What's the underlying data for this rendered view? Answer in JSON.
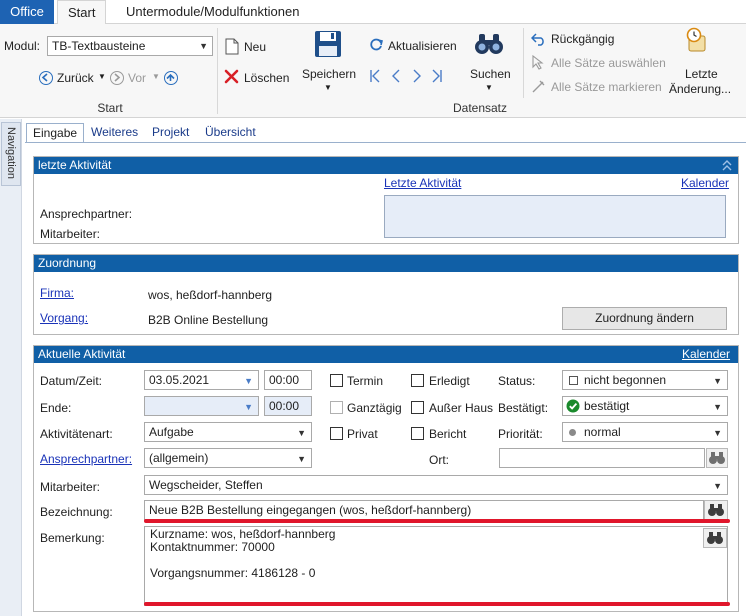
{
  "ribbon_tabs": [
    "Office",
    "Start",
    "Untermodule/Modulfunktionen"
  ],
  "modul": {
    "label": "Modul:",
    "value": "TB-Textbausteine"
  },
  "nav": {
    "back": "Zurück",
    "forward": "Vor",
    "group_label": "Start"
  },
  "actions": {
    "neu": "Neu",
    "loeschen": "Löschen",
    "speichern": "Speichern",
    "aktualisieren": "Aktualisieren",
    "suchen": "Suchen",
    "datensatz_label": "Datensatz",
    "rueckgaengig": "Rückgängig",
    "alle_auswaehlen": "Alle Sätze auswählen",
    "alle_markieren": "Alle Sätze markieren",
    "letzte_line1": "Letzte",
    "letzte_line2": "Änderung..."
  },
  "navigation_panel": "Navigation",
  "content_tabs": [
    "Eingabe",
    "Weiteres",
    "Projekt",
    "Übersicht"
  ],
  "letzte_aktivitaet": {
    "title": "letzte Aktivität",
    "link_letzte": "Letzte Aktivität",
    "link_kalender": "Kalender",
    "ansprechpartner_label": "Ansprechpartner:",
    "mitarbeiter_label": "Mitarbeiter:"
  },
  "zuordnung": {
    "title": "Zuordnung",
    "firma_label": "Firma:",
    "firma_value": "wos, heßdorf-hannberg",
    "vorgang_label": "Vorgang:",
    "vorgang_value": "B2B Online Bestellung",
    "button": "Zuordnung ändern"
  },
  "aktivitaet": {
    "title": "Aktuelle Aktivität",
    "kalender": "Kalender",
    "datum_label": "Datum/Zeit:",
    "datum_value": "03.05.2021",
    "zeit_value": "00:00",
    "ende_label": "Ende:",
    "ende_zeit": "00:00",
    "termin": "Termin",
    "erledigt": "Erledigt",
    "ganztaegig": "Ganztägig",
    "ausser_haus": "Außer Haus",
    "privat": "Privat",
    "bericht": "Bericht",
    "status_label": "Status:",
    "status_value": "nicht begonnen",
    "bestaetigt_label": "Bestätigt:",
    "bestaetigt_value": "bestätigt",
    "prioritaet_label": "Priorität:",
    "prioritaet_value": "normal",
    "art_label": "Aktivitätenart:",
    "art_value": "Aufgabe",
    "ansprechpartner_label": "Ansprechpartner:",
    "ansprechpartner_value": "(allgemein)",
    "ort_label": "Ort:",
    "mitarbeiter_label": "Mitarbeiter:",
    "mitarbeiter_value": "Wegscheider, Steffen",
    "bezeichnung_label": "Bezeichnung:",
    "bezeichnung_value": "Neue B2B Bestellung eingegangen (wos, heßdorf-hannberg)",
    "bemerkung_label": "Bemerkung:",
    "bemerkung_line1": "Kurzname: wos, heßdorf-hannberg",
    "bemerkung_line2": "Kontaktnummer: 70000",
    "bemerkung_line3": "Vorgangsnummer: 4186128 - 0"
  },
  "colors": {
    "office_tab": "#1e63b3",
    "section_header": "#105fa6",
    "link": "#1a33b8",
    "highlight_underline": "#e0162b",
    "confirmed_green": "#1a8a2c"
  },
  "icons": [
    "new-doc-icon",
    "delete-x-icon",
    "save-disk-icon",
    "refresh-icon",
    "binoculars-icon",
    "undo-icon",
    "select-all-icon",
    "mark-all-icon",
    "clock-scroll-icon",
    "calendar-dropdown-icon",
    "check-circle-icon",
    "gray-dot-icon"
  ]
}
